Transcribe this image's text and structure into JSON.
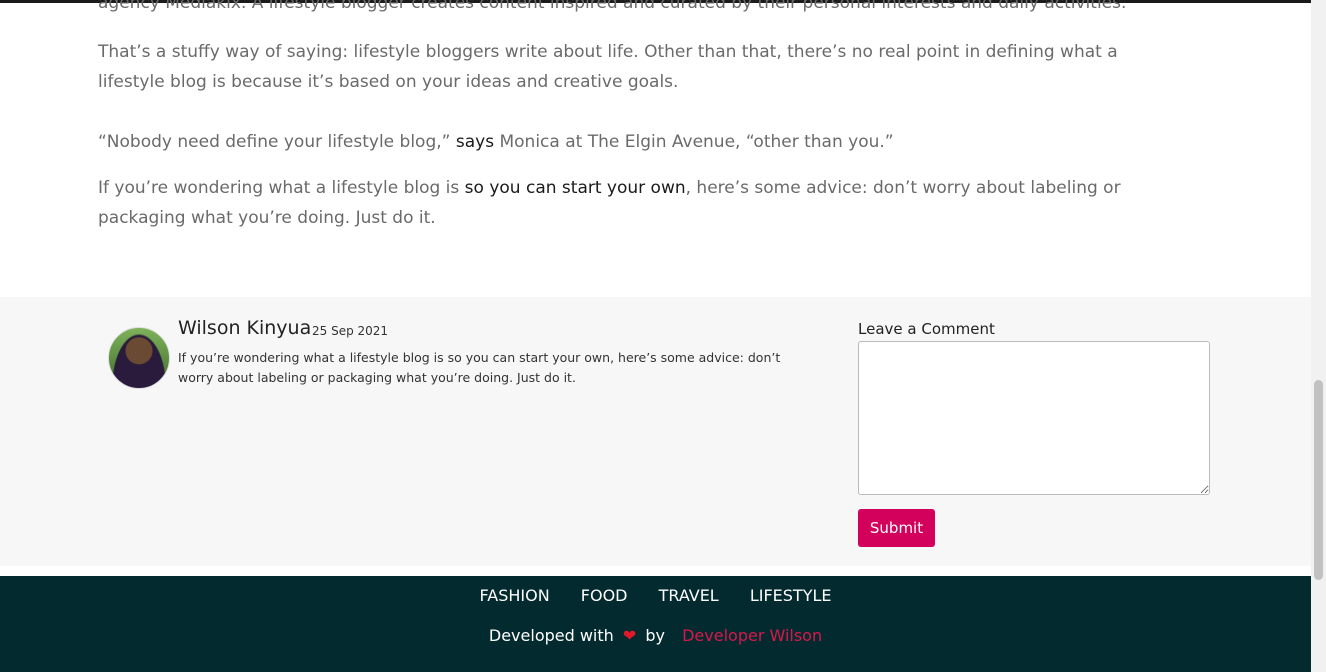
{
  "article": {
    "p0": "agency Mediakix.  A lifestyle blogger creates content inspired and curated by their personal interests and daily activities.",
    "p1": "That’s a stuffy way of saying: lifestyle bloggers write about life. Other than that, there’s no real point in defining what a lifestyle blog is because it’s based on your ideas and creative goals.",
    "p2_pre": "“Nobody need define your lifestyle blog,” ",
    "p2_link": "says",
    "p2_post": " Monica at The Elgin Avenue, “other than you.”",
    "p3_pre": "If you’re wondering what a lifestyle blog is ",
    "p3_link": "so you can start your own",
    "p3_post": ", here’s some advice: don’t worry about labeling or packaging what you’re doing. Just do it."
  },
  "comment": {
    "author": "Wilson Kinyua",
    "date": "25 Sep 2021",
    "text": "If you’re wondering what a lifestyle blog is so you can start your own, here’s some advice: don’t worry about labeling or packaging what you’re doing. Just do it."
  },
  "form": {
    "label": "Leave a Comment",
    "value": "",
    "submit": "Submit"
  },
  "footer": {
    "nav": [
      "FASHION",
      "FOOD",
      "TRAVEL",
      "LIFESTYLE"
    ],
    "credit_pre": "Developed with",
    "heart": "❤",
    "credit_mid": "by",
    "credit_link": "Developer Wilson"
  },
  "colors": {
    "accent": "#d3005c",
    "footer_bg": "#032b2f"
  }
}
